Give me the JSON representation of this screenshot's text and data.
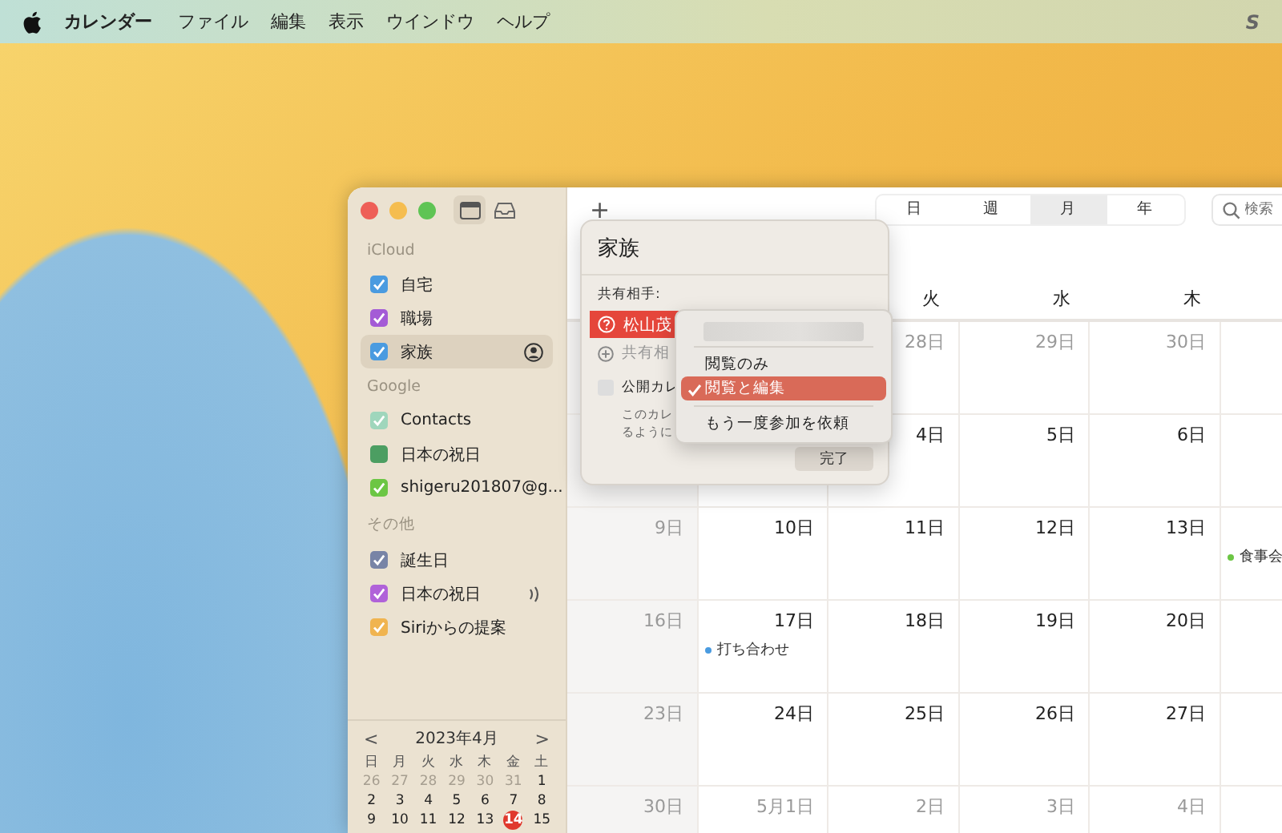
{
  "menu_bar": {
    "app_name": "カレンダー",
    "items": [
      "ファイル",
      "編集",
      "表示",
      "ウインドウ",
      "ヘルプ"
    ],
    "extra": "S"
  },
  "sidebar": {
    "sections": [
      {
        "title": "iCloud",
        "items": [
          {
            "label": "自宅",
            "color": "#4a9be0",
            "checked": true,
            "selected": false
          },
          {
            "label": "職場",
            "color": "#a45bd6",
            "checked": true,
            "selected": false
          },
          {
            "label": "家族",
            "color": "#4a9be0",
            "checked": true,
            "selected": true,
            "shared": true
          }
        ]
      },
      {
        "title": "Google",
        "items": [
          {
            "label": "Contacts",
            "color": "#9fd6bc",
            "checked": true,
            "selected": false
          },
          {
            "label": "日本の祝日",
            "color": "#4c9e62",
            "checked": false,
            "selected": false
          },
          {
            "label": "shigeru201807@g...",
            "color": "#6cc644",
            "checked": true,
            "selected": false
          }
        ]
      },
      {
        "title": "その他",
        "items": [
          {
            "label": "誕生日",
            "color": "#7884a6",
            "checked": true,
            "selected": false
          },
          {
            "label": "日本の祝日",
            "color": "#b062d9",
            "checked": true,
            "selected": false,
            "subscribed": true
          },
          {
            "label": "Siriからの提案",
            "color": "#f0b450",
            "checked": true,
            "selected": false
          }
        ]
      }
    ]
  },
  "mini_calendar": {
    "title": "2023年4月",
    "prev": "<",
    "next": ">",
    "weekdays": [
      "日",
      "月",
      "火",
      "水",
      "木",
      "金",
      "土"
    ],
    "weeks": [
      [
        {
          "d": "26",
          "dim": true
        },
        {
          "d": "27",
          "dim": true
        },
        {
          "d": "28",
          "dim": true
        },
        {
          "d": "29",
          "dim": true
        },
        {
          "d": "30",
          "dim": true
        },
        {
          "d": "31",
          "dim": true
        },
        {
          "d": "1",
          "dim": false
        }
      ],
      [
        {
          "d": "2",
          "dim": false
        },
        {
          "d": "3",
          "dim": false
        },
        {
          "d": "4",
          "dim": false
        },
        {
          "d": "5",
          "dim": false
        },
        {
          "d": "6",
          "dim": false
        },
        {
          "d": "7",
          "dim": false
        },
        {
          "d": "8",
          "dim": false
        }
      ],
      [
        {
          "d": "9",
          "dim": false
        },
        {
          "d": "10",
          "dim": false
        },
        {
          "d": "11",
          "dim": false
        },
        {
          "d": "12",
          "dim": false
        },
        {
          "d": "13",
          "dim": false
        },
        {
          "d": "14",
          "dim": false,
          "today": true
        },
        {
          "d": "15",
          "dim": false
        }
      ]
    ]
  },
  "toolbar": {
    "add": "+",
    "views": [
      {
        "label": "日",
        "selected": false
      },
      {
        "label": "週",
        "selected": false
      },
      {
        "label": "月",
        "selected": true
      },
      {
        "label": "年",
        "selected": false
      }
    ],
    "search_placeholder": "検索"
  },
  "calendar": {
    "weekdays": {
      "tue": "火",
      "wed": "水",
      "thu": "木"
    },
    "weeks": [
      {
        "tue": {
          "day": "28日",
          "dim": true
        },
        "wed": {
          "day": "29日",
          "dim": true
        },
        "thu": {
          "day": "30日",
          "dim": true
        }
      },
      {
        "tue": {
          "day": "4日",
          "dim": false
        },
        "wed": {
          "day": "5日",
          "dim": false
        },
        "thu": {
          "day": "6日",
          "dim": false
        }
      },
      {
        "sun": {
          "day": "9日",
          "dim": true
        },
        "mon": {
          "day": "10日",
          "dim": false
        },
        "tue": {
          "day": "11日",
          "dim": false
        },
        "wed": {
          "day": "12日",
          "dim": false
        },
        "thu": {
          "day": "13日",
          "dim": false
        },
        "fri": {
          "events": [
            {
              "title": "食事会",
              "color": "#6cc644"
            }
          ]
        }
      },
      {
        "sun": {
          "day": "16日",
          "dim": true
        },
        "mon": {
          "day": "17日",
          "dim": false,
          "events": [
            {
              "title": "打ち合わせ",
              "color": "#4a9be0"
            }
          ]
        },
        "tue": {
          "day": "18日",
          "dim": false
        },
        "wed": {
          "day": "19日",
          "dim": false
        },
        "thu": {
          "day": "20日",
          "dim": false
        }
      },
      {
        "sun": {
          "day": "23日",
          "dim": true
        },
        "mon": {
          "day": "24日",
          "dim": false
        },
        "tue": {
          "day": "25日",
          "dim": false
        },
        "wed": {
          "day": "26日",
          "dim": false
        },
        "thu": {
          "day": "27日",
          "dim": false
        }
      },
      {
        "sun": {
          "day": "30日",
          "dim": true
        },
        "mon": {
          "day": "5月1日",
          "dim": true
        },
        "tue": {
          "day": "2日",
          "dim": true
        },
        "wed": {
          "day": "3日",
          "dim": true
        },
        "thu": {
          "day": "4日",
          "dim": true
        }
      }
    ]
  },
  "popover": {
    "title": "家族",
    "shared_with_label": "共有相手:",
    "person": "松山茂",
    "add_placeholder": "共有相",
    "public_label": "公開カレ",
    "public_checked": false,
    "public_note": [
      "このカレ",
      "るように"
    ],
    "done": "完了"
  },
  "context_menu": {
    "items": [
      {
        "kind": "blurred"
      },
      {
        "kind": "separator"
      },
      {
        "kind": "option",
        "label": "閲覧のみ",
        "selected": false
      },
      {
        "kind": "option",
        "label": "閲覧と編集",
        "selected": true
      },
      {
        "kind": "separator"
      },
      {
        "kind": "option",
        "label": "もう一度参加を依頼",
        "selected": false
      }
    ]
  }
}
